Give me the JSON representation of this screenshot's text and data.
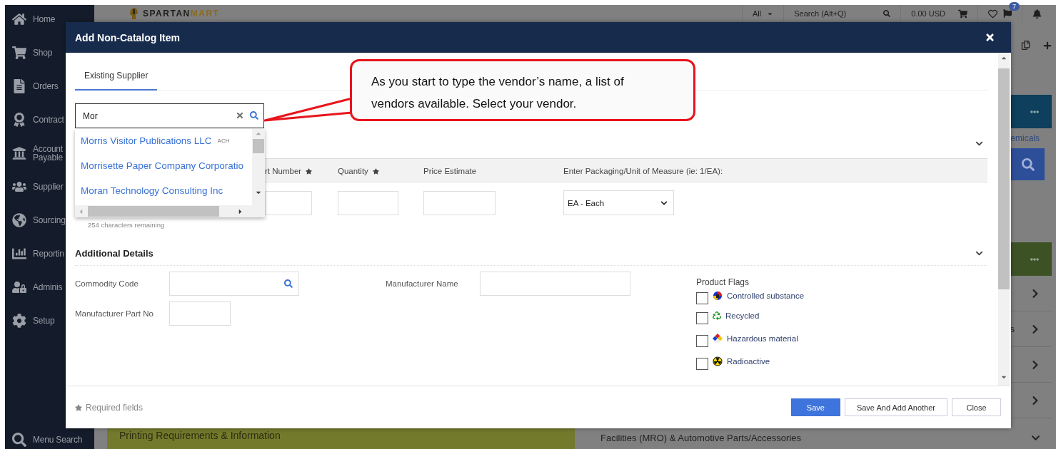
{
  "sidebar": {
    "items": [
      {
        "label": "Home"
      },
      {
        "label": "Shop"
      },
      {
        "label": "Orders"
      },
      {
        "label": "Contract"
      },
      {
        "label": "Account Payable"
      },
      {
        "label": "Supplier"
      },
      {
        "label": "Sourcing"
      },
      {
        "label": "Reportin"
      },
      {
        "label": "Adminis"
      },
      {
        "label": "Setup"
      }
    ],
    "menu_search": "Menu Search"
  },
  "top_bar": {
    "logo_dark": "SPARTAN",
    "logo_light": "MART",
    "scope": "All",
    "search_placeholder": "Search (Alt+Q)",
    "cart_total": "0.00 USD",
    "notifications_badge": "7"
  },
  "background": {
    "link_fragment": "emicals",
    "row_fragment": "s",
    "facilities": "Facilities (MRO) & Automotive Parts/Accessories",
    "printing": "Printing Requirements & Information"
  },
  "modal": {
    "title": "Add Non-Catalog Item",
    "tabs": [
      {
        "label": "Existing Supplier",
        "selected": true
      }
    ],
    "supplier_search": {
      "value": "Mor"
    },
    "suggestions": [
      {
        "name": "Morris Visitor Publications LLC",
        "badge": "ACH"
      },
      {
        "name": "Morrisette Paper Company Corporatio"
      },
      {
        "name": "Moran Technology Consulting Inc"
      }
    ],
    "item_columns": [
      {
        "label": "rt Number",
        "required": true
      },
      {
        "label": "Quantity",
        "required": true
      },
      {
        "label": "Price Estimate",
        "required": false
      },
      {
        "label": "Enter Packaging/Unit of Measure (ie: 1/EA):",
        "required": false
      }
    ],
    "unit_select": {
      "value": "EA - Each"
    },
    "chars_remaining": "254 characters remaining",
    "additional_details": {
      "title": "Additional Details"
    },
    "fields": [
      {
        "label": "Commodity Code",
        "kind": "search"
      },
      {
        "label": "Manufacturer Name",
        "kind": "text"
      },
      {
        "label": "Manufacturer Part No",
        "kind": "short"
      }
    ],
    "product_flags": {
      "title": "Product Flags",
      "items": [
        {
          "label": "Controlled substance",
          "checked": false
        },
        {
          "label": "Recycled",
          "checked": false
        },
        {
          "label": "Hazardous material",
          "checked": false
        },
        {
          "label": "Radioactive",
          "checked": false
        }
      ]
    },
    "required_note": "Required fields",
    "buttons": [
      {
        "label": "Save",
        "kind": "primary"
      },
      {
        "label": "Save And Add Another",
        "kind": "secondary"
      },
      {
        "label": "Close",
        "kind": "secondary"
      }
    ]
  },
  "callout": {
    "text": "As you start to type the vendor’s name, a list of vendors available. Select your vendor."
  }
}
